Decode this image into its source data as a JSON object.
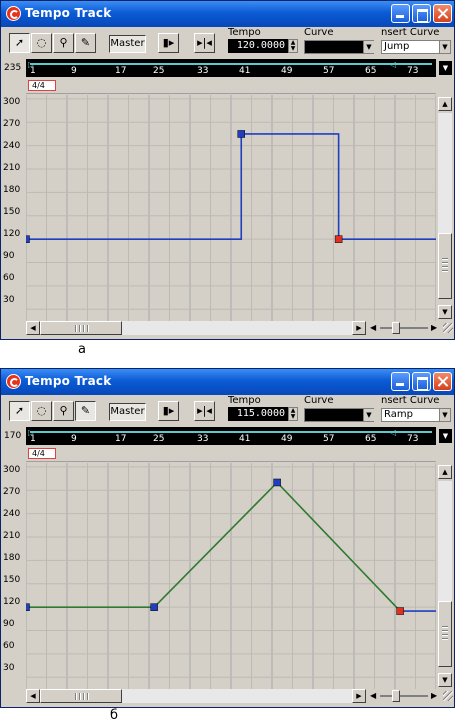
{
  "window_a": {
    "title": "Tempo Track",
    "toolbar": {
      "master_label": "Master",
      "tempo_label": "Tempo",
      "tempo_value": "120.0000",
      "curve_label": "Curve",
      "curve_value": "",
      "insert_curve_label": "nsert Curve",
      "insert_curve_value": "Jump"
    },
    "ruler_value": "235",
    "ruler_labels": [
      "1",
      "9",
      "17",
      "25",
      "33",
      "41",
      "49",
      "57",
      "65",
      "73"
    ],
    "signature": "4/4",
    "y_ticks": [
      "300",
      "270",
      "240",
      "210",
      "180",
      "150",
      "120",
      "90",
      "60",
      "30"
    ],
    "caption": "а",
    "chart_data": {
      "type": "line",
      "curve": "Jump",
      "line_color": "#1f3fbf",
      "ylim": [
        15,
        305
      ],
      "xlim": [
        1,
        81
      ],
      "points": [
        {
          "x": 1,
          "y": 120
        },
        {
          "x": 43,
          "y": 120
        },
        {
          "x": 43,
          "y": 255
        },
        {
          "x": 62,
          "y": 255
        },
        {
          "x": 62,
          "y": 120
        },
        {
          "x": 81,
          "y": 120
        }
      ],
      "markers": [
        {
          "x": 1,
          "y": 120,
          "color": "#1f3fbf"
        },
        {
          "x": 43,
          "y": 255,
          "color": "#1f3fbf"
        },
        {
          "x": 62,
          "y": 120,
          "color": "#e03020"
        }
      ]
    }
  },
  "window_b": {
    "title": "Tempo Track",
    "toolbar": {
      "master_label": "Master",
      "tempo_label": "Tempo",
      "tempo_value": "115.0000",
      "curve_label": "Curve",
      "curve_value": "",
      "insert_curve_label": "nsert Curve",
      "insert_curve_value": "Ramp"
    },
    "ruler_value": "170",
    "ruler_labels": [
      "1",
      "9",
      "17",
      "25",
      "33",
      "41",
      "49",
      "57",
      "65",
      "73"
    ],
    "signature": "4/4",
    "y_ticks": [
      "300",
      "270",
      "240",
      "210",
      "180",
      "150",
      "120",
      "90",
      "60",
      "30"
    ],
    "caption": "б",
    "chart_data": {
      "type": "line",
      "curve": "Ramp",
      "line_color": "#2e7a2e",
      "tail_color": "#1f3fbf",
      "ylim": [
        15,
        305
      ],
      "xlim": [
        1,
        81
      ],
      "points": [
        {
          "x": 1,
          "y": 120
        },
        {
          "x": 26,
          "y": 120
        },
        {
          "x": 50,
          "y": 280
        },
        {
          "x": 74,
          "y": 115
        }
      ],
      "tail": [
        {
          "x": 74,
          "y": 115
        },
        {
          "x": 81,
          "y": 115
        }
      ],
      "markers": [
        {
          "x": 1,
          "y": 120,
          "color": "#1f3fbf"
        },
        {
          "x": 26,
          "y": 120,
          "color": "#1f3fbf"
        },
        {
          "x": 50,
          "y": 280,
          "color": "#1f3fbf"
        },
        {
          "x": 74,
          "y": 115,
          "color": "#e03020"
        }
      ]
    }
  }
}
